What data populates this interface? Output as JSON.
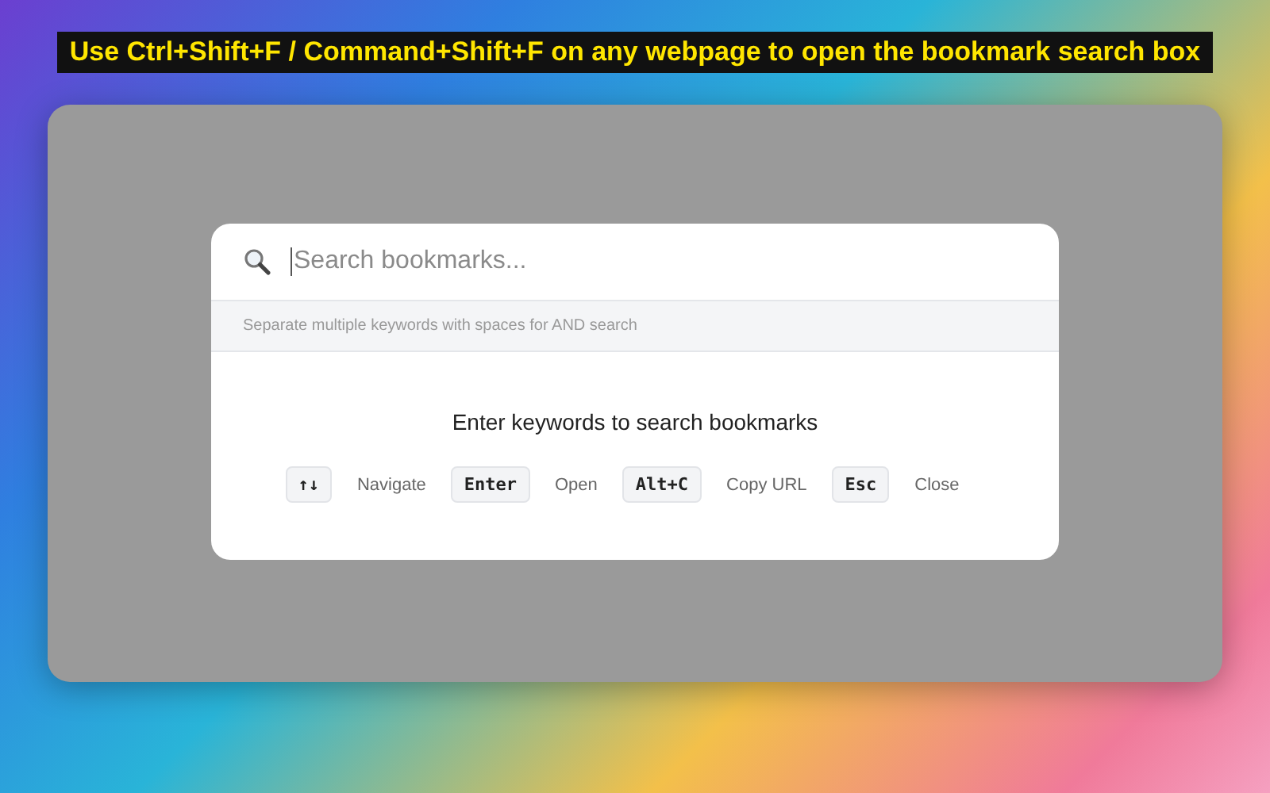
{
  "banner": {
    "text": "Use Ctrl+Shift+F / Command+Shift+F on any webpage to open the bookmark search box"
  },
  "search": {
    "placeholder": "Search bookmarks...",
    "hint": "Separate multiple keywords with spaces for AND search"
  },
  "empty_message": "Enter keywords to search bookmarks",
  "shortcuts": [
    {
      "key": "↑↓",
      "action": "Navigate"
    },
    {
      "key": "Enter",
      "action": "Open"
    },
    {
      "key": "Alt+C",
      "action": "Copy URL"
    },
    {
      "key": "Esc",
      "action": "Close"
    }
  ]
}
